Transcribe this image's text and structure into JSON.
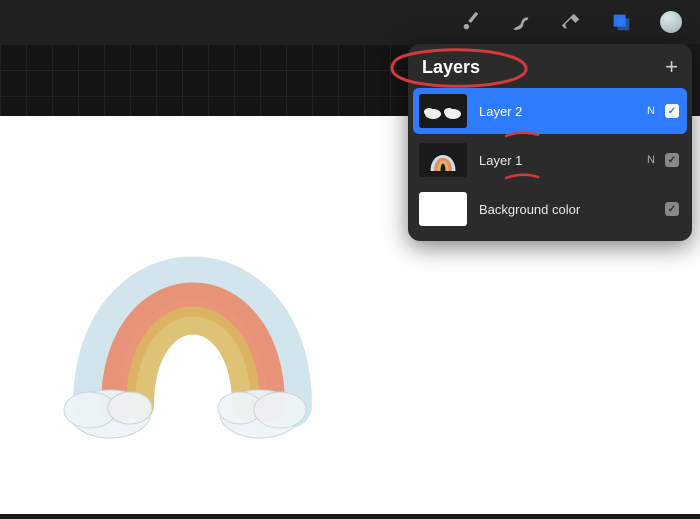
{
  "toolbar": {
    "brush_icon": "paint-brush",
    "smudge_icon": "smudge",
    "eraser_icon": "eraser",
    "layers_icon": "layers",
    "color_icon": "color-swatch",
    "active_tool": "layers",
    "current_color": "#b9cdd1"
  },
  "panel": {
    "title": "Layers",
    "add_label": "+"
  },
  "layers": [
    {
      "name": "Layer 2",
      "mode": "N",
      "visible": true,
      "selected": true,
      "thumb": "clouds"
    },
    {
      "name": "Layer 1",
      "mode": "N",
      "visible": true,
      "selected": false,
      "thumb": "rainbow"
    },
    {
      "name": "Background color",
      "mode": "",
      "visible": true,
      "selected": false,
      "thumb": "bg"
    }
  ],
  "annotation": {
    "circle_target": "Layers",
    "underline_targets": [
      "Layer 2",
      "Layer 1"
    ],
    "stroke": "#d33b3a"
  },
  "canvas": {
    "artwork": "rainbow with two clouds",
    "background": "#ffffff"
  }
}
